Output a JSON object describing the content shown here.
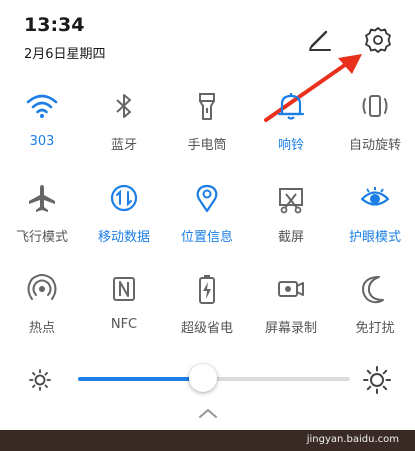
{
  "status": {
    "time": "13:34",
    "date": "2月6日星期四"
  },
  "header_icons": [
    "edit-icon",
    "gear-icon"
  ],
  "tiles": [
    {
      "label": "303",
      "icon": "wifi-icon",
      "active": true
    },
    {
      "label": "蓝牙",
      "icon": "bluetooth-icon",
      "active": false
    },
    {
      "label": "手电筒",
      "icon": "flashlight-icon",
      "active": false
    },
    {
      "label": "响铃",
      "icon": "bell-icon",
      "active": true
    },
    {
      "label": "自动旋转",
      "icon": "rotate-icon",
      "active": false
    },
    {
      "label": "飞行模式",
      "icon": "airplane-icon",
      "active": false
    },
    {
      "label": "移动数据",
      "icon": "mobile-data-icon",
      "active": true
    },
    {
      "label": "位置信息",
      "icon": "location-icon",
      "active": true
    },
    {
      "label": "截屏",
      "icon": "screenshot-icon",
      "active": false
    },
    {
      "label": "护眼模式",
      "icon": "eye-icon",
      "active": true
    },
    {
      "label": "热点",
      "icon": "hotspot-icon",
      "active": false
    },
    {
      "label": "NFC",
      "icon": "nfc-icon",
      "active": false
    },
    {
      "label": "超级省电",
      "icon": "battery-icon",
      "active": false
    },
    {
      "label": "屏幕录制",
      "icon": "screen-record-icon",
      "active": false
    },
    {
      "label": "免打扰",
      "icon": "moon-icon",
      "active": false
    }
  ],
  "brightness": {
    "level": 0.46
  },
  "colors": {
    "active": "#1d7fe5",
    "inactive": "#555555"
  },
  "watermark": "jingyan.baidu.com"
}
